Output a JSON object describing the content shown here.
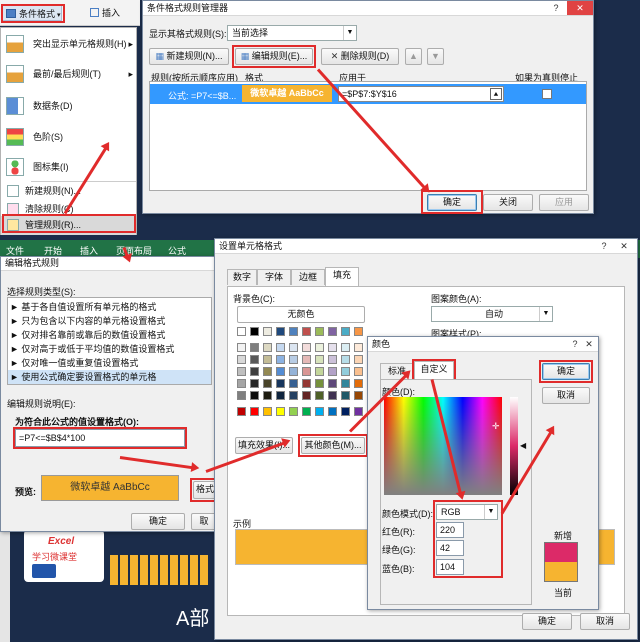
{
  "ribbon": {
    "cond_format": "条件格式",
    "insert": "插入"
  },
  "menu": {
    "items": [
      "突出显示单元格规则(H)",
      "最前/最后规则(T)",
      "数据条(D)",
      "色阶(S)",
      "图标集(I)",
      "新建规则(N)...",
      "清除规则(C)",
      "管理规则(R)..."
    ],
    "colors": {
      "accent": "#e02b2b"
    }
  },
  "mgr": {
    "title": "条件格式规则管理器",
    "show_label": "显示其格式规则(S):",
    "show_value": "当前选择",
    "new_btn": "新建规则(N)...",
    "edit_btn": "编辑规则(E)...",
    "del_btn": "删除规则(D)",
    "col_rule": "规则(按所示顺序应用)",
    "col_format": "格式",
    "col_applies": "应用于",
    "col_stop": "如果为真则停止",
    "row_rule": "公式: =P7<=$B...",
    "row_format": "微软卓越  AaBbCc",
    "row_applies": "=$P$7:$Y$16",
    "ok": "确定",
    "close": "关闭",
    "apply": "应用"
  },
  "excel": {
    "tabs": [
      "文件",
      "开始",
      "插入",
      "页面布局",
      "公式"
    ],
    "logo": "Excel",
    "logo_sub": "学习微课堂",
    "big": "A部"
  },
  "edit": {
    "title": "编辑格式规则",
    "select_type": "选择规则类型(S):",
    "types": [
      "基于各自值设置所有单元格的格式",
      "只为包含以下内容的单元格设置格式",
      "仅对排名靠前或靠后的数值设置格式",
      "仅对高于或低于平均值的数值设置格式",
      "仅对唯一值或重复值设置格式",
      "使用公式确定要设置格式的单元格"
    ],
    "desc": "编辑规则说明(E):",
    "formula_label": "为符合此公式的值设置格式(O):",
    "formula": "=P7<=$B$4*100",
    "preview_label": "预览:",
    "preview_text": "微软卓越  AaBbCc",
    "format_btn": "格式",
    "ok": "确定",
    "cancel": "取"
  },
  "fmt": {
    "title": "设置单元格格式",
    "tabs": [
      "数字",
      "字体",
      "边框",
      "填充"
    ],
    "bg_label": "背景色(C):",
    "no_color": "无颜色",
    "pattern_color": "图案颜色(A):",
    "pattern_value": "自动",
    "pattern_style": "图案样式(P):",
    "fill_effects": "填充效果(I)...",
    "more_colors": "其他颜色(M)...",
    "sample": "示例",
    "fill": "#f6b430"
  },
  "color": {
    "title": "颜色",
    "tab_std": "标准",
    "tab_custom": "自定义",
    "colors_label": "颜色(D):",
    "model_label": "颜色模式(D):",
    "model": "RGB",
    "red_label": "红色(R):",
    "green_label": "绿色(G):",
    "blue_label": "蓝色(B):",
    "red": "220",
    "green": "42",
    "blue": "104",
    "new": "新增",
    "current": "当前",
    "ok": "确定",
    "cancel": "取消",
    "new_color": "#dc2a68",
    "cur_color": "#f6b430"
  }
}
